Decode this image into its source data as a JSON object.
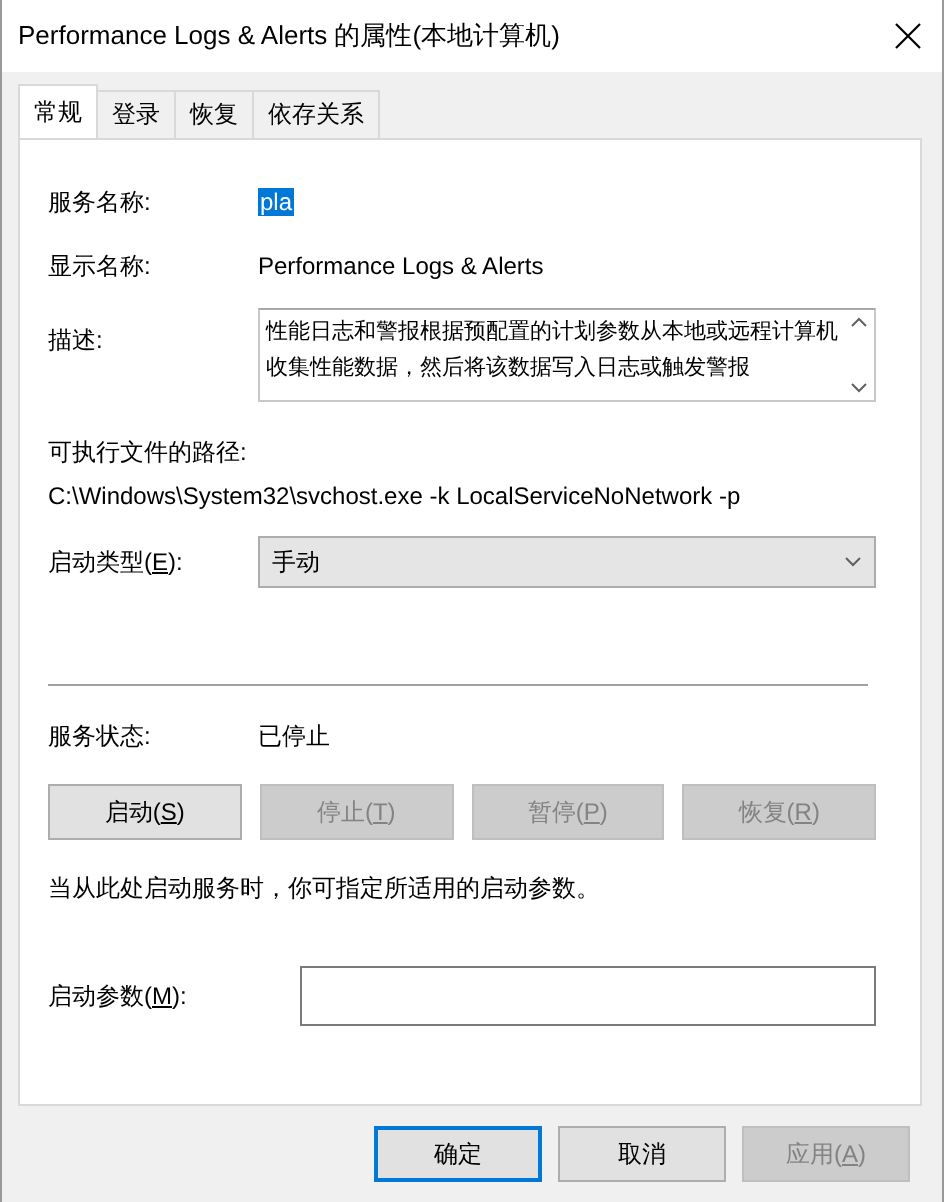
{
  "window": {
    "title": "Performance Logs & Alerts 的属性(本地计算机)"
  },
  "tabs": [
    {
      "label": "常规",
      "selected": true
    },
    {
      "label": "登录",
      "selected": false
    },
    {
      "label": "恢复",
      "selected": false
    },
    {
      "label": "依存关系",
      "selected": false
    }
  ],
  "service_name": {
    "label": "服务名称:",
    "value": "pla",
    "highlighted": true
  },
  "display_name": {
    "label": "显示名称:",
    "value": "Performance Logs & Alerts"
  },
  "description": {
    "label": "描述:",
    "value": "性能日志和警报根据预配置的计划参数从本地或远程计算机收集性能数据，然后将该数据写入日志或触发警报"
  },
  "executable_path": {
    "label": "可执行文件的路径:",
    "value": "C:\\Windows\\System32\\svchost.exe -k LocalServiceNoNetwork -p"
  },
  "startup_type": {
    "label": "启动类型(E):",
    "access_key": true,
    "value": "手动"
  },
  "service_status": {
    "label": "服务状态:",
    "value": "已停止"
  },
  "control_buttons": [
    {
      "label": "启动(S)",
      "access_key": true,
      "disabled": false
    },
    {
      "label": "停止(T)",
      "access_key": true,
      "disabled": true
    },
    {
      "label": "暂停(P)",
      "access_key": true,
      "disabled": true
    },
    {
      "label": "恢复(R)",
      "access_key": true,
      "disabled": true
    }
  ],
  "hint": "当从此处启动服务时，你可指定所适用的启动参数。",
  "start_parameters": {
    "label": "启动参数(M):",
    "access_key": true
  },
  "dialog_buttons": [
    {
      "label": "确定",
      "access_key": false,
      "default": true,
      "disabled": false
    },
    {
      "label": "取消",
      "access_key": false,
      "default": false,
      "disabled": false
    },
    {
      "label": "应用(A)",
      "access_key": true,
      "default": false,
      "disabled": true
    }
  ]
}
